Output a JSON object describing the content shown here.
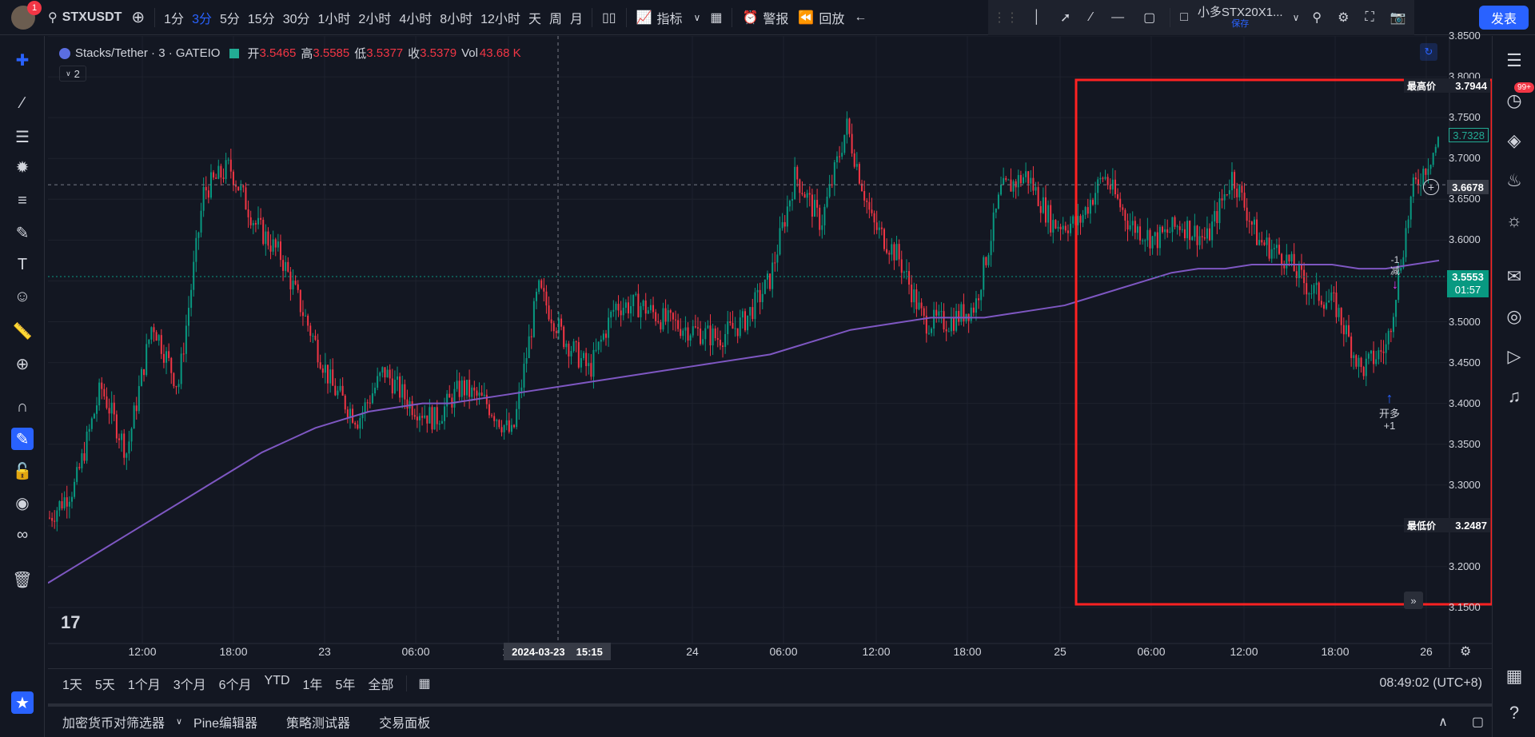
{
  "topbar": {
    "avatar_badge": "1",
    "symbol": "STXUSDT",
    "intervals": [
      "1分",
      "3分",
      "5分",
      "15分",
      "30分",
      "1小时",
      "2小时",
      "4小时",
      "8小时",
      "12小时",
      "天",
      "周",
      "月"
    ],
    "indicators_label": "指标",
    "alert_label": "警报",
    "replay_label": "回放",
    "layout_name": "小多STX20X1...",
    "layout_sub": "保存",
    "publish_label": "发表"
  },
  "legend": {
    "title": "Stacks/Tether · 3 · GATEIO",
    "open_label": "开",
    "open": "3.5465",
    "high_label": "高",
    "high": "3.5585",
    "low_label": "低",
    "low": "3.5377",
    "close_label": "收",
    "close": "3.5379",
    "vol_label": "Vol",
    "vol": "43.68 K",
    "collapsed_count": "2"
  },
  "price_axis": {
    "ticks": [
      "3.8500",
      "3.8000",
      "3.7500",
      "3.7000",
      "3.6500",
      "3.6000",
      "3.5500",
      "3.5000",
      "3.4500",
      "3.4000",
      "3.3500",
      "3.3000",
      "3.2500",
      "3.2000",
      "3.1500"
    ],
    "high_label": "最高价",
    "high_value": "3.7944",
    "low_label": "最低价",
    "low_value": "3.2487",
    "ma_value": "3.7328",
    "crosshair_value": "3.6678",
    "current_price": "3.5553",
    "countdown": "01:57"
  },
  "time_axis": {
    "ticks": [
      "12:00",
      "18:00",
      "23",
      "06:00",
      "12",
      "24",
      "06:00",
      "12:00",
      "18:00",
      "25",
      "06:00",
      "12:00",
      "18:00",
      "26"
    ],
    "crosshair_date": "2024-03-23",
    "crosshair_time": "15:15"
  },
  "markers": {
    "long_label": "开多",
    "long_qty": "+1",
    "reduce_label": "减",
    "reduce_qty": "-1"
  },
  "bottombar": {
    "ranges": [
      "1天",
      "5天",
      "1个月",
      "3个月",
      "6个月",
      "YTD",
      "1年",
      "5年",
      "全部"
    ],
    "clock": "08:49:02 (UTC+8)"
  },
  "footer": {
    "tabs": [
      "加密货币对筛选器",
      "Pine编辑器",
      "策略测试器",
      "交易面板"
    ]
  },
  "rightbar": {
    "badge": "99+"
  },
  "colors": {
    "up": "#089981",
    "down": "#f23645",
    "ma": "#7e57c2",
    "accent": "#2962ff",
    "highlight_box": "#ff2222"
  },
  "chart_data": {
    "type": "candlestick",
    "ylim": [
      3.15,
      3.85
    ],
    "ma_series": [
      3.18,
      3.2,
      3.22,
      3.24,
      3.26,
      3.28,
      3.3,
      3.32,
      3.34,
      3.355,
      3.37,
      3.38,
      3.39,
      3.395,
      3.4,
      3.4,
      3.405,
      3.41,
      3.415,
      3.42,
      3.425,
      3.43,
      3.435,
      3.44,
      3.445,
      3.45,
      3.455,
      3.46,
      3.47,
      3.48,
      3.49,
      3.495,
      3.5,
      3.505,
      3.505,
      3.505,
      3.51,
      3.515,
      3.52,
      3.53,
      3.54,
      3.55,
      3.56,
      3.565,
      3.565,
      3.57,
      3.57,
      3.57,
      3.57,
      3.565,
      3.565,
      3.57,
      3.575
    ],
    "price_series": [
      3.26,
      3.3,
      3.42,
      3.34,
      3.5,
      3.42,
      3.66,
      3.69,
      3.62,
      3.58,
      3.5,
      3.42,
      3.38,
      3.44,
      3.4,
      3.38,
      3.42,
      3.4,
      3.36,
      3.54,
      3.48,
      3.44,
      3.52,
      3.52,
      3.5,
      3.49,
      3.48,
      3.5,
      3.55,
      3.68,
      3.62,
      3.74,
      3.62,
      3.58,
      3.5,
      3.5,
      3.52,
      3.66,
      3.68,
      3.62,
      3.62,
      3.68,
      3.62,
      3.6,
      3.62,
      3.6,
      3.68,
      3.6,
      3.58,
      3.54,
      3.52,
      3.44,
      3.47,
      3.66,
      3.72
    ]
  }
}
